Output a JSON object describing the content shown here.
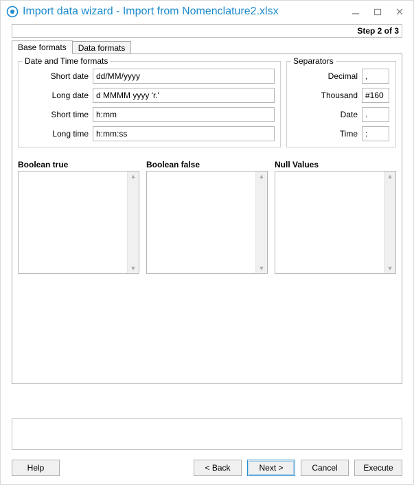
{
  "window": {
    "title": "Import data wizard - Import from Nomenclature2.xlsx",
    "step_text": "Step 2 of 3"
  },
  "tabs": {
    "base_formats": "Base formats",
    "data_formats": "Data formats"
  },
  "groups": {
    "datetime_legend": "Date and Time formats",
    "separators_legend": "Separators"
  },
  "datetime": {
    "short_date_label": "Short date",
    "short_date_value": "dd/MM/yyyy",
    "long_date_label": "Long date",
    "long_date_value": "d MMMM yyyy 'r.'",
    "short_time_label": "Short time",
    "short_time_value": "h:mm",
    "long_time_label": "Long time",
    "long_time_value": "h:mm:ss"
  },
  "separators": {
    "decimal_label": "Decimal",
    "decimal_value": ",",
    "thousand_label": "Thousand",
    "thousand_value": "#160",
    "date_label": "Date",
    "date_value": ".",
    "time_label": "Time",
    "time_value": ":"
  },
  "lists": {
    "boolean_true_title": "Boolean true",
    "boolean_false_title": "Boolean false",
    "null_values_title": "Null Values"
  },
  "buttons": {
    "help": "Help",
    "back": "< Back",
    "next": "Next >",
    "cancel": "Cancel",
    "execute": "Execute"
  }
}
